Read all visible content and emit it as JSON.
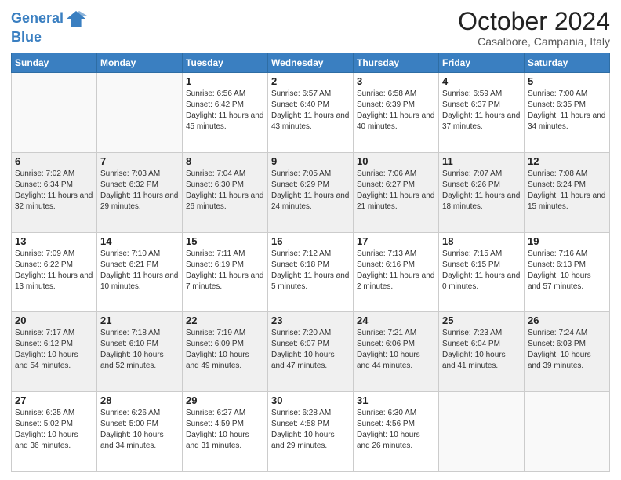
{
  "header": {
    "logo_line1": "General",
    "logo_line2": "Blue",
    "month": "October 2024",
    "location": "Casalbore, Campania, Italy"
  },
  "weekdays": [
    "Sunday",
    "Monday",
    "Tuesday",
    "Wednesday",
    "Thursday",
    "Friday",
    "Saturday"
  ],
  "weeks": [
    [
      {
        "day": "",
        "info": ""
      },
      {
        "day": "",
        "info": ""
      },
      {
        "day": "1",
        "info": "Sunrise: 6:56 AM\nSunset: 6:42 PM\nDaylight: 11 hours and 45 minutes."
      },
      {
        "day": "2",
        "info": "Sunrise: 6:57 AM\nSunset: 6:40 PM\nDaylight: 11 hours and 43 minutes."
      },
      {
        "day": "3",
        "info": "Sunrise: 6:58 AM\nSunset: 6:39 PM\nDaylight: 11 hours and 40 minutes."
      },
      {
        "day": "4",
        "info": "Sunrise: 6:59 AM\nSunset: 6:37 PM\nDaylight: 11 hours and 37 minutes."
      },
      {
        "day": "5",
        "info": "Sunrise: 7:00 AM\nSunset: 6:35 PM\nDaylight: 11 hours and 34 minutes."
      }
    ],
    [
      {
        "day": "6",
        "info": "Sunrise: 7:02 AM\nSunset: 6:34 PM\nDaylight: 11 hours and 32 minutes."
      },
      {
        "day": "7",
        "info": "Sunrise: 7:03 AM\nSunset: 6:32 PM\nDaylight: 11 hours and 29 minutes."
      },
      {
        "day": "8",
        "info": "Sunrise: 7:04 AM\nSunset: 6:30 PM\nDaylight: 11 hours and 26 minutes."
      },
      {
        "day": "9",
        "info": "Sunrise: 7:05 AM\nSunset: 6:29 PM\nDaylight: 11 hours and 24 minutes."
      },
      {
        "day": "10",
        "info": "Sunrise: 7:06 AM\nSunset: 6:27 PM\nDaylight: 11 hours and 21 minutes."
      },
      {
        "day": "11",
        "info": "Sunrise: 7:07 AM\nSunset: 6:26 PM\nDaylight: 11 hours and 18 minutes."
      },
      {
        "day": "12",
        "info": "Sunrise: 7:08 AM\nSunset: 6:24 PM\nDaylight: 11 hours and 15 minutes."
      }
    ],
    [
      {
        "day": "13",
        "info": "Sunrise: 7:09 AM\nSunset: 6:22 PM\nDaylight: 11 hours and 13 minutes."
      },
      {
        "day": "14",
        "info": "Sunrise: 7:10 AM\nSunset: 6:21 PM\nDaylight: 11 hours and 10 minutes."
      },
      {
        "day": "15",
        "info": "Sunrise: 7:11 AM\nSunset: 6:19 PM\nDaylight: 11 hours and 7 minutes."
      },
      {
        "day": "16",
        "info": "Sunrise: 7:12 AM\nSunset: 6:18 PM\nDaylight: 11 hours and 5 minutes."
      },
      {
        "day": "17",
        "info": "Sunrise: 7:13 AM\nSunset: 6:16 PM\nDaylight: 11 hours and 2 minutes."
      },
      {
        "day": "18",
        "info": "Sunrise: 7:15 AM\nSunset: 6:15 PM\nDaylight: 11 hours and 0 minutes."
      },
      {
        "day": "19",
        "info": "Sunrise: 7:16 AM\nSunset: 6:13 PM\nDaylight: 10 hours and 57 minutes."
      }
    ],
    [
      {
        "day": "20",
        "info": "Sunrise: 7:17 AM\nSunset: 6:12 PM\nDaylight: 10 hours and 54 minutes."
      },
      {
        "day": "21",
        "info": "Sunrise: 7:18 AM\nSunset: 6:10 PM\nDaylight: 10 hours and 52 minutes."
      },
      {
        "day": "22",
        "info": "Sunrise: 7:19 AM\nSunset: 6:09 PM\nDaylight: 10 hours and 49 minutes."
      },
      {
        "day": "23",
        "info": "Sunrise: 7:20 AM\nSunset: 6:07 PM\nDaylight: 10 hours and 47 minutes."
      },
      {
        "day": "24",
        "info": "Sunrise: 7:21 AM\nSunset: 6:06 PM\nDaylight: 10 hours and 44 minutes."
      },
      {
        "day": "25",
        "info": "Sunrise: 7:23 AM\nSunset: 6:04 PM\nDaylight: 10 hours and 41 minutes."
      },
      {
        "day": "26",
        "info": "Sunrise: 7:24 AM\nSunset: 6:03 PM\nDaylight: 10 hours and 39 minutes."
      }
    ],
    [
      {
        "day": "27",
        "info": "Sunrise: 6:25 AM\nSunset: 5:02 PM\nDaylight: 10 hours and 36 minutes."
      },
      {
        "day": "28",
        "info": "Sunrise: 6:26 AM\nSunset: 5:00 PM\nDaylight: 10 hours and 34 minutes."
      },
      {
        "day": "29",
        "info": "Sunrise: 6:27 AM\nSunset: 4:59 PM\nDaylight: 10 hours and 31 minutes."
      },
      {
        "day": "30",
        "info": "Sunrise: 6:28 AM\nSunset: 4:58 PM\nDaylight: 10 hours and 29 minutes."
      },
      {
        "day": "31",
        "info": "Sunrise: 6:30 AM\nSunset: 4:56 PM\nDaylight: 10 hours and 26 minutes."
      },
      {
        "day": "",
        "info": ""
      },
      {
        "day": "",
        "info": ""
      }
    ]
  ]
}
